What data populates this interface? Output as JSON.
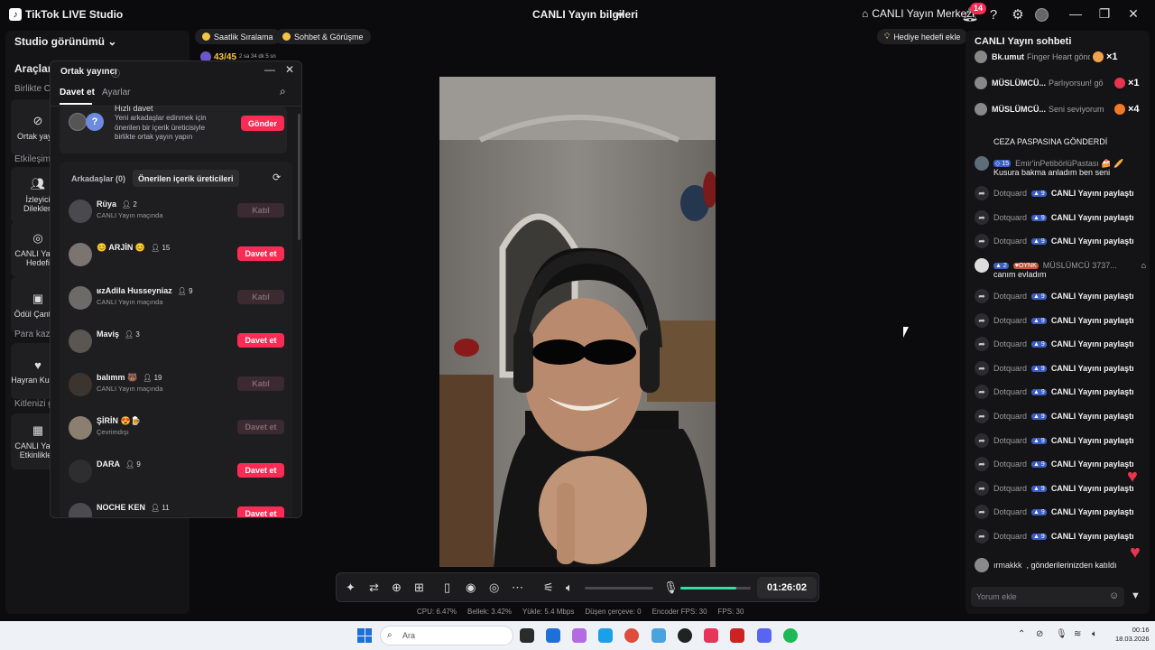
{
  "titlebar": {
    "app_title": "TikTok LIVE Studio",
    "center_title": "CANLI Yayın bilgileri",
    "hub_label": "CANLI Yayın Merkezi",
    "notif_count": "14"
  },
  "left": {
    "studio_view": "Studio görünümü",
    "tools": "Araçlar",
    "section_together": "Birlikte CA",
    "tile_cohost": "Ortak yayın",
    "section_engagement": "Etkileşim",
    "tile_requests": "İzleyici Dilekleri",
    "tile_goal": "CANLI Yayın Hedefi",
    "tile_treasure": "Ödül Çantası",
    "section_earn": "Para kazan",
    "tile_fanclub": "Hayran Kulübü",
    "section_audience": "Kitlenizi g",
    "tile_events": "CANLI Yayın Etkinlikleri"
  },
  "top_pills": {
    "hourly": "Saatlik Sıralama",
    "chat_meet": "Sohbet & Görüşme",
    "gift_goal": "Hediye hedefi ekle",
    "counter": "43/45",
    "counter_sub": "2 sa 34 dk 5 sn"
  },
  "cohost_panel": {
    "title": "Ortak yayıncı",
    "tab_invite": "Davet et",
    "tab_settings": "Ayarlar",
    "quick_title": "Hızlı davet",
    "quick_desc": "Yeni arkadaşlar edinmek için önerilen bir içerik üreticisiyle birlikte ortak yayın yapın",
    "send_label": "Gönder",
    "friends_tab": "Arkadaşlar (0)",
    "suggested_tab": "Önerilen içerik üreticileri",
    "rows": [
      {
        "name": "Rüya",
        "count": "2",
        "status": "CANLI Yayın maçında",
        "button": "Katıl",
        "active": false
      },
      {
        "name": "😊 ARJİN 😊",
        "count": "15",
        "status": "",
        "button": "Davet et",
        "active": true
      },
      {
        "name": "ʁzAdila Husseyniaz",
        "count": "9",
        "status": "CANLI Yayın maçında",
        "button": "Katıl",
        "active": false
      },
      {
        "name": "Maviş",
        "count": "3",
        "status": "",
        "button": "Davet et",
        "active": true
      },
      {
        "name": "balımm 🐻",
        "count": "19",
        "status": "CANLI Yayın maçında",
        "button": "Katıl",
        "active": false
      },
      {
        "name": "ŞİRİN 😍🍺",
        "count": "",
        "status": "Çevrimdışı",
        "button": "Davet et",
        "active": false
      },
      {
        "name": "DARA",
        "count": "9",
        "status": "",
        "button": "Davet et",
        "active": true
      },
      {
        "name": "NOCHE KEN",
        "count": "11",
        "status": "",
        "button": "Davet et",
        "active": true
      }
    ]
  },
  "chat": {
    "title": "CANLI Yayın sohbeti",
    "gifts": [
      {
        "name": "Bk.umut",
        "text": "Finger Heart gönderdi",
        "mult": "×1",
        "color": "#f2a24a"
      },
      {
        "name": "MÜSLÜMCÜ...",
        "text": "Parlıyorsun! gö",
        "mult": "×1",
        "color": "#e8344c"
      },
      {
        "name": "MÜSLÜMCÜ...",
        "text": "Seni seviyorum",
        "mult": "×4",
        "color": "#f07a2a"
      }
    ],
    "msg_partial": "CEZA PASPASINA GÖNDERDİ",
    "msg2_level": "15",
    "msg2_name": "Emir'inPetibörlüPastası 🍰 🥖",
    "msg2_text": "Kusura bakma anladım ben seni",
    "share_name": "Dotquard",
    "share_level": "9",
    "share_text": "CANLI Yayını paylaştı",
    "msg3_level": "2",
    "msg3_tag": "OYNK",
    "msg3_name": "MÜSLÜMCÜ 3737...",
    "msg3_text": "canım evladım",
    "join_name": "ırmakkk",
    "join_text": ", gönderilerinizden katıldı",
    "comment_placeholder": "Yorum ekle"
  },
  "controls": {
    "timer": "01:26:02",
    "volume_level": 0.0,
    "mic_level": 0.8
  },
  "stats": {
    "cpu": "CPU:  6.47%",
    "memory": "Bellek:  3.42%",
    "upload": "Yükle:  5.4 Mbps",
    "dropped": "Düşen çerçeve:  0",
    "encoder": "Encoder FPS:  30",
    "fps": "FPS:  30"
  },
  "taskbar": {
    "search": "Ara",
    "time": "00:16",
    "date": "18.03.2026"
  }
}
